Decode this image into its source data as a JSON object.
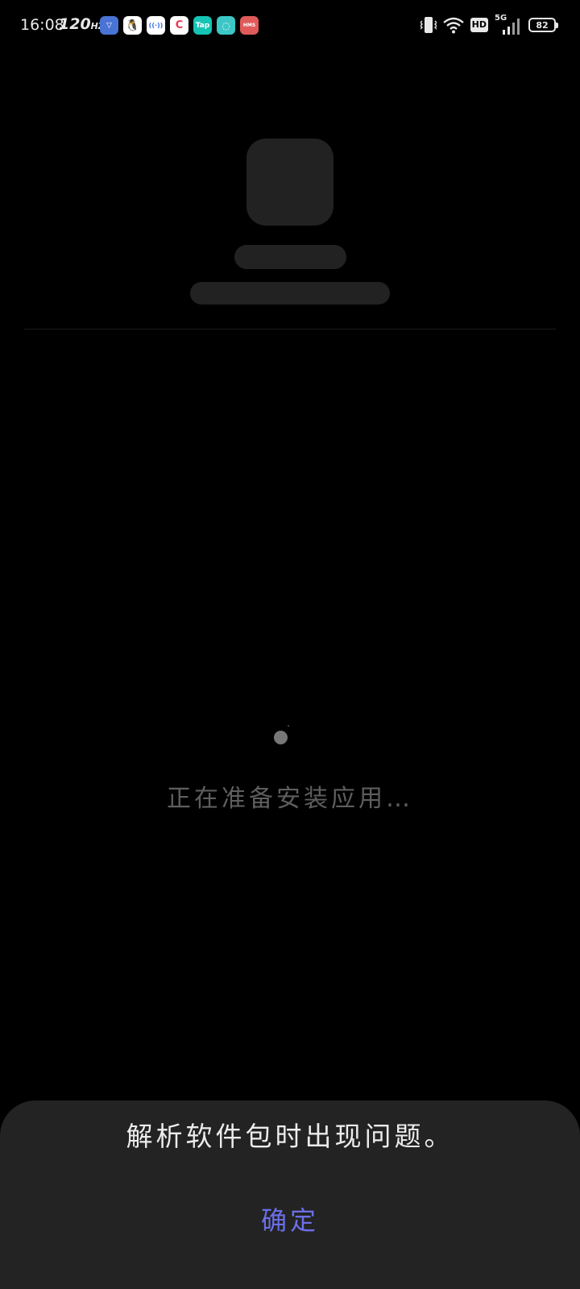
{
  "status_bar": {
    "time": "16:08",
    "refresh_rate": "120",
    "refresh_unit": "HZ",
    "notification_icons": [
      {
        "name": "cleaner-app-icon",
        "glyph": "▽"
      },
      {
        "name": "qq-app-icon",
        "glyph": "🐧"
      },
      {
        "name": "browser-app-icon",
        "glyph": "((·))"
      },
      {
        "name": "cmcc-app-icon",
        "glyph": "C"
      },
      {
        "name": "taptap-app-icon",
        "glyph": "Tap"
      },
      {
        "name": "chat-app-icon",
        "glyph": "◌"
      },
      {
        "name": "hms-app-icon",
        "glyph": "HMS"
      }
    ],
    "hd_label": "HD",
    "network_label": "5G",
    "battery_level": "82"
  },
  "main": {
    "loading_text": "正在准备安装应用…"
  },
  "dialog": {
    "message": "解析软件包时出现问题。",
    "confirm_label": "确定"
  }
}
